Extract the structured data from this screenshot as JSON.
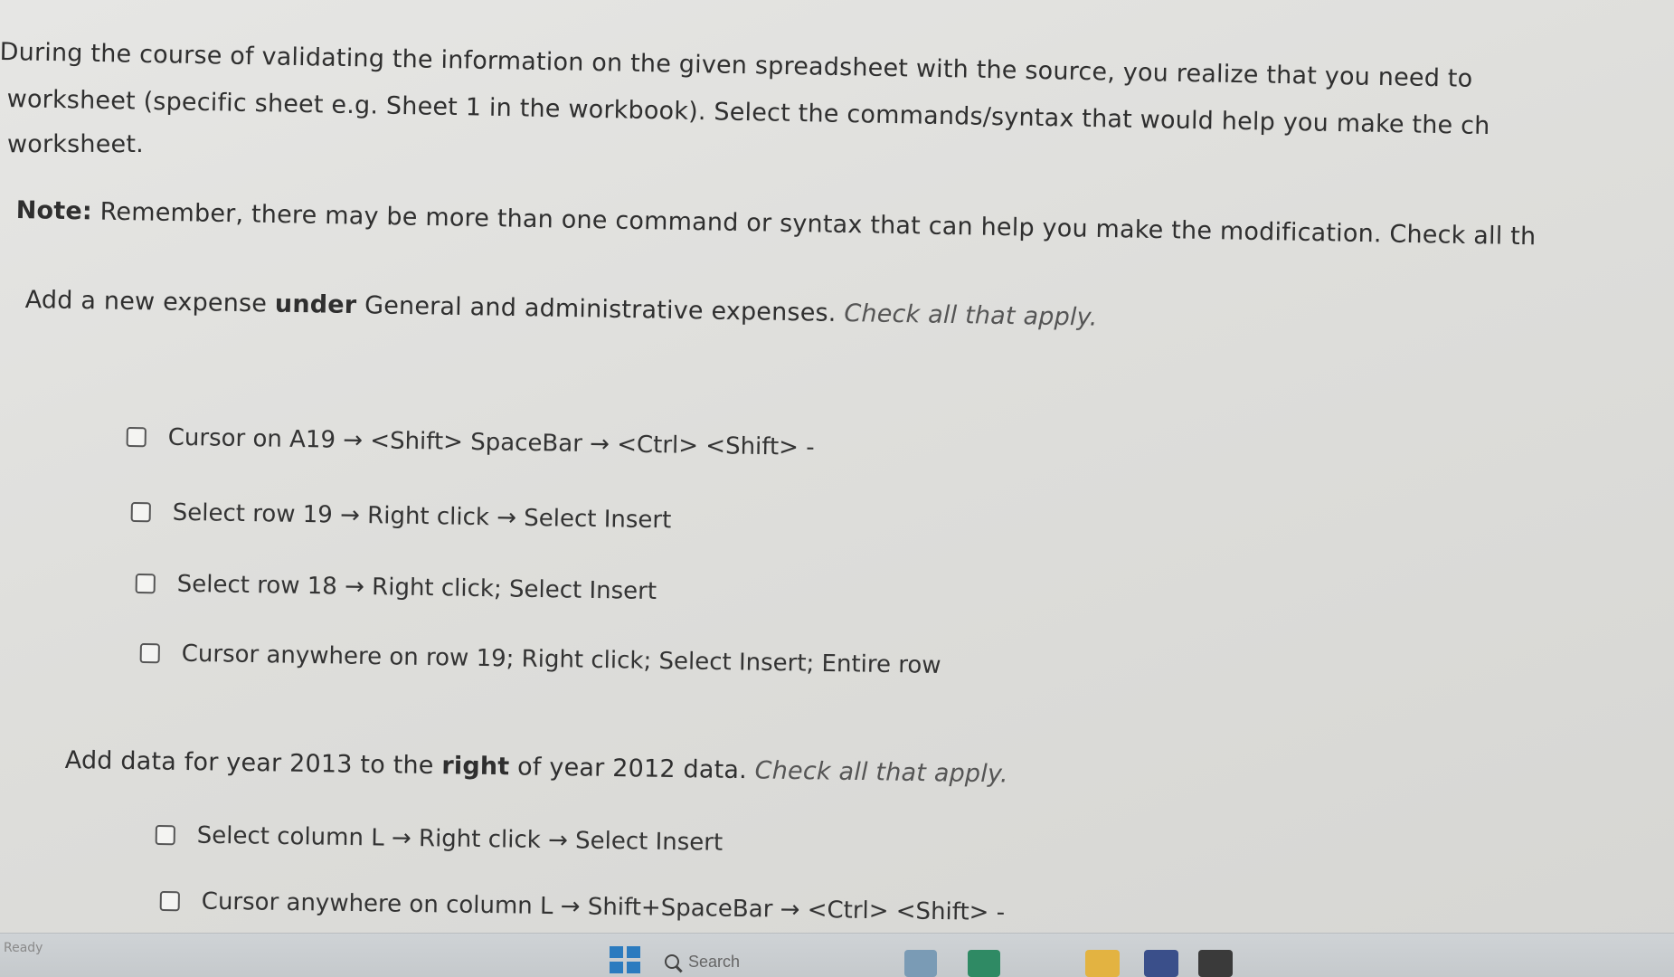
{
  "question": {
    "line1": "During the course of validating the information on the given spreadsheet with the source, you realize that you need to",
    "line2": "worksheet (specific sheet e.g. Sheet 1 in the workbook). Select the commands/syntax that would help you make the ch",
    "line3": "worksheet.",
    "note_label": "Note:",
    "note_text": " Remember, there may be more than one command or syntax that can help you make the modification. Check all th"
  },
  "section1": {
    "prompt_start": "Add a new expense ",
    "prompt_bold": "under",
    "prompt_end": " General and administrative expenses. ",
    "prompt_italic": "Check all that apply.",
    "options": [
      "Cursor on A19 → <Shift> SpaceBar → <Ctrl> <Shift> -",
      "Select row 19 → Right click → Select Insert",
      "Select row 18 → Right click; Select Insert",
      "Cursor anywhere on row 19; Right click; Select Insert; Entire row"
    ]
  },
  "section2": {
    "prompt_start": "Add data for year 2013 to the ",
    "prompt_bold": "right",
    "prompt_end": " of year 2012 data. ",
    "prompt_italic": "Check all that apply.",
    "options": [
      "Select column L → Right click → Select Insert",
      "Cursor anywhere on column L → Shift+SpaceBar → <Ctrl> <Shift> -"
    ]
  },
  "taskbar": {
    "status": "Ready",
    "search_placeholder": "Search",
    "icons": [
      "start-icon",
      "search-icon",
      "weather-icon",
      "app-icon",
      "file-explorer-icon",
      "store-icon",
      "app-icon"
    ]
  }
}
